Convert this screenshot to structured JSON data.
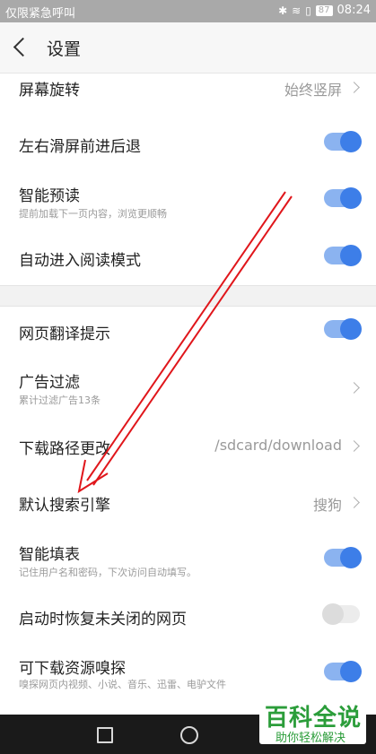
{
  "status_bar": {
    "carrier": "仅限紧急呼叫",
    "battery": "87",
    "time": "08:24",
    "icons": [
      "bluetooth-icon",
      "wifi-icon",
      "sim-icon",
      "battery-icon"
    ]
  },
  "header": {
    "title": "设置"
  },
  "settings": [
    {
      "label": "屏幕旋转",
      "value": "始终竖屏",
      "control": "chevron"
    },
    {
      "label": "左右滑屏前进后退",
      "control": "toggle",
      "on": true
    },
    {
      "label": "智能预读",
      "sub": "提前加载下一页内容，浏览更顺畅",
      "control": "toggle",
      "on": true
    },
    {
      "label": "自动进入阅读模式",
      "control": "toggle",
      "on": true
    },
    {
      "label": "网页翻译提示",
      "control": "toggle",
      "on": true
    },
    {
      "label": "广告过滤",
      "sub": "累计过滤广告13条",
      "control": "chevron"
    },
    {
      "label": "下载路径更改",
      "value": "/sdcard/download",
      "control": "chevron"
    },
    {
      "label": "默认搜索引擎",
      "value": "搜狗",
      "control": "chevron"
    },
    {
      "label": "智能填表",
      "sub": "记住用户名和密码，下次访问自动填写。",
      "control": "toggle",
      "on": true
    },
    {
      "label": "启动时恢复未关闭的网页",
      "control": "toggle",
      "on": false
    },
    {
      "label": "可下载资源嗅探",
      "sub": "嗅探网页内视频、小说、音乐、迅雷、电驴文件",
      "control": "toggle",
      "on": true
    }
  ],
  "watermark": {
    "title": "百科全说",
    "subtitle": "助你轻松解决"
  },
  "colors": {
    "accent": "#3d7ee8",
    "annotation_arrow": "#e0161b",
    "watermark": "#2b9d3a"
  }
}
